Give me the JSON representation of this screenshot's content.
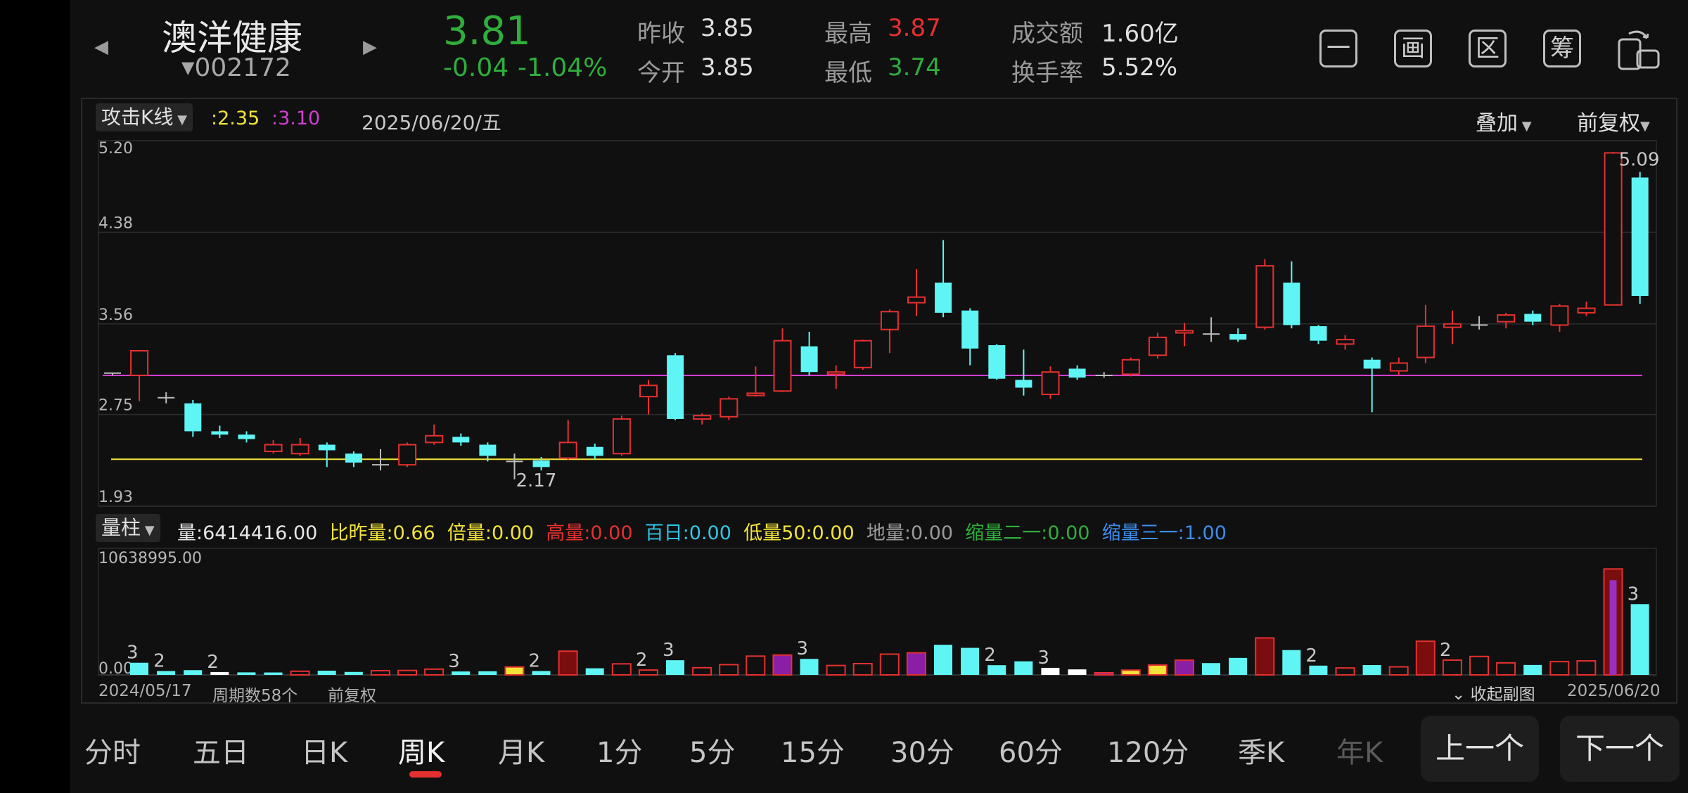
{
  "header": {
    "stock_name": "澳洋健康",
    "stock_code": "002172",
    "price": "3.81",
    "change": "-0.04",
    "change_pct": "-1.04%",
    "prev_close_label": "昨收",
    "prev_close": "3.85",
    "open_label": "今开",
    "open": "3.85",
    "high_label": "最高",
    "high": "3.87",
    "low_label": "最低",
    "low": "3.74",
    "amount_label": "成交额",
    "amount": "1.60亿",
    "turnover_label": "换手率",
    "turnover": "5.52%",
    "toolbar_icons": [
      "一",
      "画",
      "区",
      "筹"
    ]
  },
  "chart": {
    "indicator": "攻击K线",
    "ma1": ":2.35",
    "ma2": ":3.10",
    "date": "2025/06/20/五",
    "overlay": "叠加",
    "adjust": "前复权",
    "y_ticks": [
      "5.20",
      "4.38",
      "3.56",
      "2.75",
      "1.93"
    ],
    "max_label": "5.09",
    "min_label": "2.17"
  },
  "volume": {
    "indicator": "量柱",
    "items": [
      {
        "label": "量:",
        "value": "6414416.00",
        "color": "#e6e6e6"
      },
      {
        "label": "比昨量:",
        "value": "0.66",
        "color": "#f2e338"
      },
      {
        "label": "倍量:",
        "value": "0.00",
        "color": "#f2e338"
      },
      {
        "label": "高量:",
        "value": "0.00",
        "color": "#e53030"
      },
      {
        "label": "百日:",
        "value": "0.00",
        "color": "#2ec6e6"
      },
      {
        "label": "低量50:",
        "value": "0.00",
        "color": "#f2e338"
      },
      {
        "label": "地量:",
        "value": "0.00",
        "color": "#9a9a9a"
      },
      {
        "label": "缩量二一:",
        "value": "0.00",
        "color": "#2fae3c"
      },
      {
        "label": "缩量三一:",
        "value": "1.00",
        "color": "#3a8ef0"
      }
    ],
    "y_max": "10638995.00",
    "y_min": "0.00"
  },
  "footer": {
    "start_date": "2024/05/17",
    "periods": "周期数58个",
    "adjust": "前复权",
    "collapse": "收起副图",
    "end_date": "2025/06/20"
  },
  "tabs": [
    "分时",
    "五日",
    "日K",
    "周K",
    "月K",
    "1分",
    "5分",
    "15分",
    "30分",
    "60分",
    "120分",
    "季K",
    "年K"
  ],
  "active_tab": "周K",
  "nav": {
    "prev": "上一个",
    "next": "下一个"
  },
  "colors": {
    "up": "#e53030",
    "down": "#5ff5f5",
    "ma_yellow": "#f2e338",
    "ma_magenta": "#d23fd2",
    "price_green": "#2fae3c"
  },
  "chart_data": {
    "type": "candlestick",
    "period": "weekly",
    "ylim": [
      1.93,
      5.2
    ],
    "ma_lines": [
      2.35,
      3.1
    ],
    "candles": [
      [
        3.12,
        3.12,
        3.12,
        3.1
      ],
      [
        3.1,
        3.32,
        3.1,
        2.87
      ],
      [
        2.9,
        2.9,
        2.95,
        2.85
      ],
      [
        2.85,
        2.6,
        2.88,
        2.55
      ],
      [
        2.6,
        2.57,
        2.65,
        2.54
      ],
      [
        2.57,
        2.53,
        2.6,
        2.5
      ],
      [
        2.42,
        2.48,
        2.52,
        2.4
      ],
      [
        2.4,
        2.48,
        2.54,
        2.38
      ],
      [
        2.48,
        2.43,
        2.5,
        2.28
      ],
      [
        2.4,
        2.32,
        2.42,
        2.28
      ],
      [
        2.3,
        2.3,
        2.44,
        2.25
      ],
      [
        2.3,
        2.48,
        2.5,
        2.28
      ],
      [
        2.5,
        2.56,
        2.66,
        2.48
      ],
      [
        2.55,
        2.5,
        2.58,
        2.47
      ],
      [
        2.48,
        2.38,
        2.5,
        2.33
      ],
      [
        2.33,
        2.33,
        2.4,
        2.17
      ],
      [
        2.34,
        2.28,
        2.37,
        2.25
      ],
      [
        2.36,
        2.5,
        2.7,
        2.34
      ],
      [
        2.46,
        2.38,
        2.49,
        2.35
      ],
      [
        2.4,
        2.71,
        2.74,
        2.38
      ],
      [
        2.91,
        3.01,
        3.06,
        2.75
      ],
      [
        3.28,
        2.71,
        3.3,
        2.7
      ],
      [
        2.71,
        2.74,
        2.76,
        2.66
      ],
      [
        2.73,
        2.89,
        2.91,
        2.7
      ],
      [
        2.92,
        2.94,
        3.18,
        2.91
      ],
      [
        2.96,
        3.41,
        3.52,
        2.95
      ],
      [
        3.36,
        3.13,
        3.49,
        3.1
      ],
      [
        3.11,
        3.13,
        3.19,
        2.98
      ],
      [
        3.17,
        3.41,
        3.42,
        3.15
      ],
      [
        3.51,
        3.67,
        3.69,
        3.3
      ],
      [
        3.75,
        3.8,
        4.05,
        3.63
      ],
      [
        3.93,
        3.66,
        4.31,
        3.62
      ],
      [
        3.68,
        3.34,
        3.7,
        3.19
      ],
      [
        3.37,
        3.07,
        3.38,
        3.06
      ],
      [
        3.06,
        2.99,
        3.33,
        2.92
      ],
      [
        2.93,
        3.13,
        3.18,
        2.89
      ],
      [
        3.16,
        3.08,
        3.19,
        3.06
      ],
      [
        3.1,
        3.1,
        3.13,
        3.08
      ],
      [
        3.11,
        3.24,
        3.26,
        3.09
      ],
      [
        3.28,
        3.44,
        3.48,
        3.25
      ],
      [
        3.48,
        3.5,
        3.57,
        3.36
      ],
      [
        3.47,
        3.47,
        3.62,
        3.4
      ],
      [
        3.47,
        3.42,
        3.52,
        3.4
      ],
      [
        3.53,
        4.08,
        4.14,
        3.51
      ],
      [
        3.93,
        3.55,
        4.12,
        3.52
      ],
      [
        3.54,
        3.41,
        3.55,
        3.38
      ],
      [
        3.38,
        3.42,
        3.46,
        3.33
      ],
      [
        3.24,
        3.16,
        3.26,
        2.77
      ],
      [
        3.14,
        3.21,
        3.26,
        3.1
      ],
      [
        3.26,
        3.54,
        3.73,
        3.21
      ],
      [
        3.53,
        3.56,
        3.68,
        3.38
      ],
      [
        3.55,
        3.55,
        3.63,
        3.51
      ],
      [
        3.58,
        3.64,
        3.66,
        3.52
      ],
      [
        3.65,
        3.58,
        3.68,
        3.55
      ],
      [
        3.55,
        3.72,
        3.74,
        3.49
      ],
      [
        3.66,
        3.7,
        3.76,
        3.63
      ],
      [
        3.73,
        5.09,
        5.1,
        3.73
      ],
      [
        4.87,
        3.81,
        4.92,
        3.74
      ]
    ]
  },
  "volume_data": {
    "ylim": [
      0,
      10638995
    ],
    "bars": [
      {
        "v": 1100000,
        "c": "cyan",
        "t": "3"
      },
      {
        "v": 350000,
        "c": "cyan",
        "t": "2"
      },
      {
        "v": 430000,
        "c": "cyan"
      },
      {
        "v": 260000,
        "c": "white",
        "t": "2"
      },
      {
        "v": 230000,
        "c": "cyan"
      },
      {
        "v": 220000,
        "c": "cyan"
      },
      {
        "v": 330000,
        "c": "red"
      },
      {
        "v": 380000,
        "c": "cyan"
      },
      {
        "v": 270000,
        "c": "cyan"
      },
      {
        "v": 380000,
        "c": "red"
      },
      {
        "v": 400000,
        "c": "red"
      },
      {
        "v": 520000,
        "c": "red"
      },
      {
        "v": 310000,
        "c": "cyan",
        "t": "3"
      },
      {
        "v": 330000,
        "c": "cyan"
      },
      {
        "v": 720000,
        "c": "yellow"
      },
      {
        "v": 350000,
        "c": "cyan",
        "t": "2"
      },
      {
        "v": 2150000,
        "c": "redfill"
      },
      {
        "v": 600000,
        "c": "cyan"
      },
      {
        "v": 1000000,
        "c": "red"
      },
      {
        "v": 440000,
        "c": "red",
        "t": "2"
      },
      {
        "v": 1330000,
        "c": "cyan",
        "t": "3"
      },
      {
        "v": 650000,
        "c": "red"
      },
      {
        "v": 930000,
        "c": "red"
      },
      {
        "v": 1700000,
        "c": "red"
      },
      {
        "v": 1800000,
        "c": "purple"
      },
      {
        "v": 1450000,
        "c": "cyan",
        "t": "3"
      },
      {
        "v": 850000,
        "c": "red"
      },
      {
        "v": 1020000,
        "c": "red"
      },
      {
        "v": 1880000,
        "c": "red"
      },
      {
        "v": 2000000,
        "c": "purple"
      },
      {
        "v": 2730000,
        "c": "cyan"
      },
      {
        "v": 2450000,
        "c": "cyan"
      },
      {
        "v": 880000,
        "c": "cyan",
        "t": "2"
      },
      {
        "v": 1230000,
        "c": "cyan"
      },
      {
        "v": 640000,
        "c": "white",
        "t": "3"
      },
      {
        "v": 500000,
        "c": "white"
      },
      {
        "v": 170000,
        "c": "purple"
      },
      {
        "v": 430000,
        "c": "yellow"
      },
      {
        "v": 890000,
        "c": "yellow"
      },
      {
        "v": 1330000,
        "c": "purple"
      },
      {
        "v": 1070000,
        "c": "cyan"
      },
      {
        "v": 1540000,
        "c": "cyan"
      },
      {
        "v": 3350000,
        "c": "redfill"
      },
      {
        "v": 2250000,
        "c": "cyan"
      },
      {
        "v": 840000,
        "c": "cyan",
        "t": "2"
      },
      {
        "v": 630000,
        "c": "red"
      },
      {
        "v": 890000,
        "c": "cyan"
      },
      {
        "v": 730000,
        "c": "red"
      },
      {
        "v": 3050000,
        "c": "redfill"
      },
      {
        "v": 1340000,
        "c": "red",
        "t": "2"
      },
      {
        "v": 1670000,
        "c": "red"
      },
      {
        "v": 1090000,
        "c": "red"
      },
      {
        "v": 900000,
        "c": "cyan"
      },
      {
        "v": 1200000,
        "c": "red"
      },
      {
        "v": 1270000,
        "c": "red"
      },
      {
        "v": 9600000,
        "c": "bigpurple"
      },
      {
        "v": 6414416,
        "c": "cyan",
        "t": "3"
      }
    ]
  }
}
